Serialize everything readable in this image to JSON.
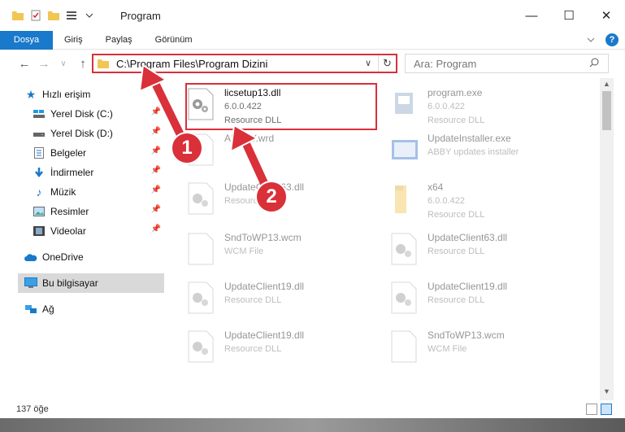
{
  "window": {
    "title": "Program"
  },
  "ribbon": {
    "tabs": [
      "Dosya",
      "Giriş",
      "Paylaş",
      "Görünüm"
    ],
    "help_label": "?"
  },
  "nav": {
    "address": "C:\\Program Files\\Program Dizini",
    "search_placeholder": "Ara: Program"
  },
  "sidebar": {
    "items": [
      {
        "label": "Hızlı erişim",
        "icon": "star-icon"
      },
      {
        "label": "Yerel Disk (C:)",
        "icon": "drive-icon"
      },
      {
        "label": "Yerel Disk (D:)",
        "icon": "drive-icon"
      },
      {
        "label": "Belgeler",
        "icon": "documents-icon"
      },
      {
        "label": "İndirmeler",
        "icon": "download-icon"
      },
      {
        "label": "Müzik",
        "icon": "music-icon"
      },
      {
        "label": "Resimler",
        "icon": "pictures-icon"
      },
      {
        "label": "Videolar",
        "icon": "video-icon"
      },
      {
        "label": "OneDrive",
        "icon": "cloud-icon"
      },
      {
        "label": "Bu bilgisayar",
        "icon": "computer-icon"
      },
      {
        "label": "Ağ",
        "icon": "network-icon"
      }
    ]
  },
  "files": [
    {
      "name": "licsetup13.dll",
      "line2": "6.0.0.422",
      "line3": "Resource DLL"
    },
    {
      "name": "program.exe",
      "line2": "6.0.0.422",
      "line3": "Resource DLL"
    },
    {
      "name": "ABBYY.wrd",
      "line2": "",
      "line3": ""
    },
    {
      "name": "UpdateInstaller.exe",
      "line2": "ABBY updates installer",
      "line3": ""
    },
    {
      "name": "UpdateClient63.dll",
      "line2": "Resource DLL",
      "line3": ""
    },
    {
      "name": "x64",
      "line2": "6.0.0.422",
      "line3": "Resource DLL"
    },
    {
      "name": "SndToWP13.wcm",
      "line2": "WCM File",
      "line3": ""
    },
    {
      "name": "UpdateClient63.dll",
      "line2": "Resource DLL",
      "line3": ""
    },
    {
      "name": "UpdateClient19.dll",
      "line2": "Resource DLL",
      "line3": ""
    },
    {
      "name": "UpdateClient19.dll",
      "line2": "Resource DLL",
      "line3": ""
    },
    {
      "name": "UpdateClient19.dll",
      "line2": "Resource DLL",
      "line3": ""
    },
    {
      "name": "SndToWP13.wcm",
      "line2": "WCM File",
      "line3": ""
    }
  ],
  "status": {
    "count": "137 öğe"
  },
  "annotations": {
    "badge1": "1",
    "badge2": "2"
  },
  "colors": {
    "accent": "#1979ca",
    "highlight": "#d9303a"
  }
}
